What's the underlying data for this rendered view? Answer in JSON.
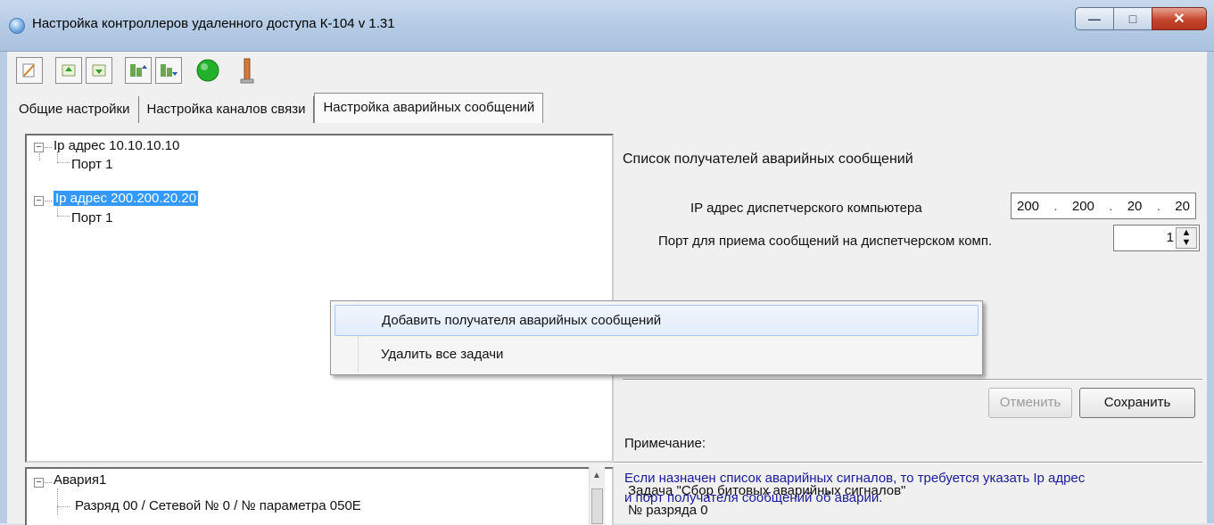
{
  "window": {
    "title": "Настройка контроллеров удаленного доступа К-104   v 1.31",
    "buttons": [
      "minimize",
      "maximize",
      "close"
    ]
  },
  "toolbar": {
    "icons": [
      "cut-icon",
      "add-green-icon",
      "add-down-icon",
      "import-icon",
      "export-icon",
      "green-circle-icon",
      "tower-icon"
    ]
  },
  "tabs": [
    {
      "label": "Общие настройки",
      "active": false
    },
    {
      "label": "Настройка каналов связи",
      "active": false
    },
    {
      "label": "Настройка аварийных сообщений",
      "active": true
    }
  ],
  "tree_top": {
    "nodes": [
      {
        "label": "Ip адрес  10.10.10.10",
        "child": "Порт 1",
        "selected": false
      },
      {
        "label": "Ip адрес  200.200.20.20",
        "child": "Порт 1",
        "selected": true
      }
    ]
  },
  "right_panel": {
    "title": "Список получателей аварийных сообщений",
    "ip_label": "IP адрес диспетчерского компьютера",
    "ip_parts": [
      "200",
      "200",
      "20",
      "20"
    ],
    "port_label": "Порт для приема сообщений  на диспетчерском комп.",
    "port_value": "1",
    "cancel_label": "Отменить",
    "save_label": "Сохранить",
    "note_label": "Примечание:",
    "note_text_1": "Если назначен список аварийных сигналов, то требуется указать Ip адрес",
    "note_text_2": "и порт получателя сообщений об аварии."
  },
  "context_menu": {
    "items": [
      {
        "label": "Добавить получателя аварийных сообщений",
        "highlighted": true
      },
      {
        "label": "Удалить все задачи",
        "highlighted": false
      }
    ]
  },
  "tree_bottom": {
    "root": "Авария1",
    "child": "Разряд 00  / Сетевой №  0 / № параметра  050E"
  },
  "task_panel": {
    "title": "Задача \"Сбор битовых аварийных сигналов\"",
    "subtitle": "№ разряда 0"
  },
  "colors": {
    "selection": "#3399ff",
    "note_text": "#1a1a9a",
    "close_button": "#c4452c"
  }
}
